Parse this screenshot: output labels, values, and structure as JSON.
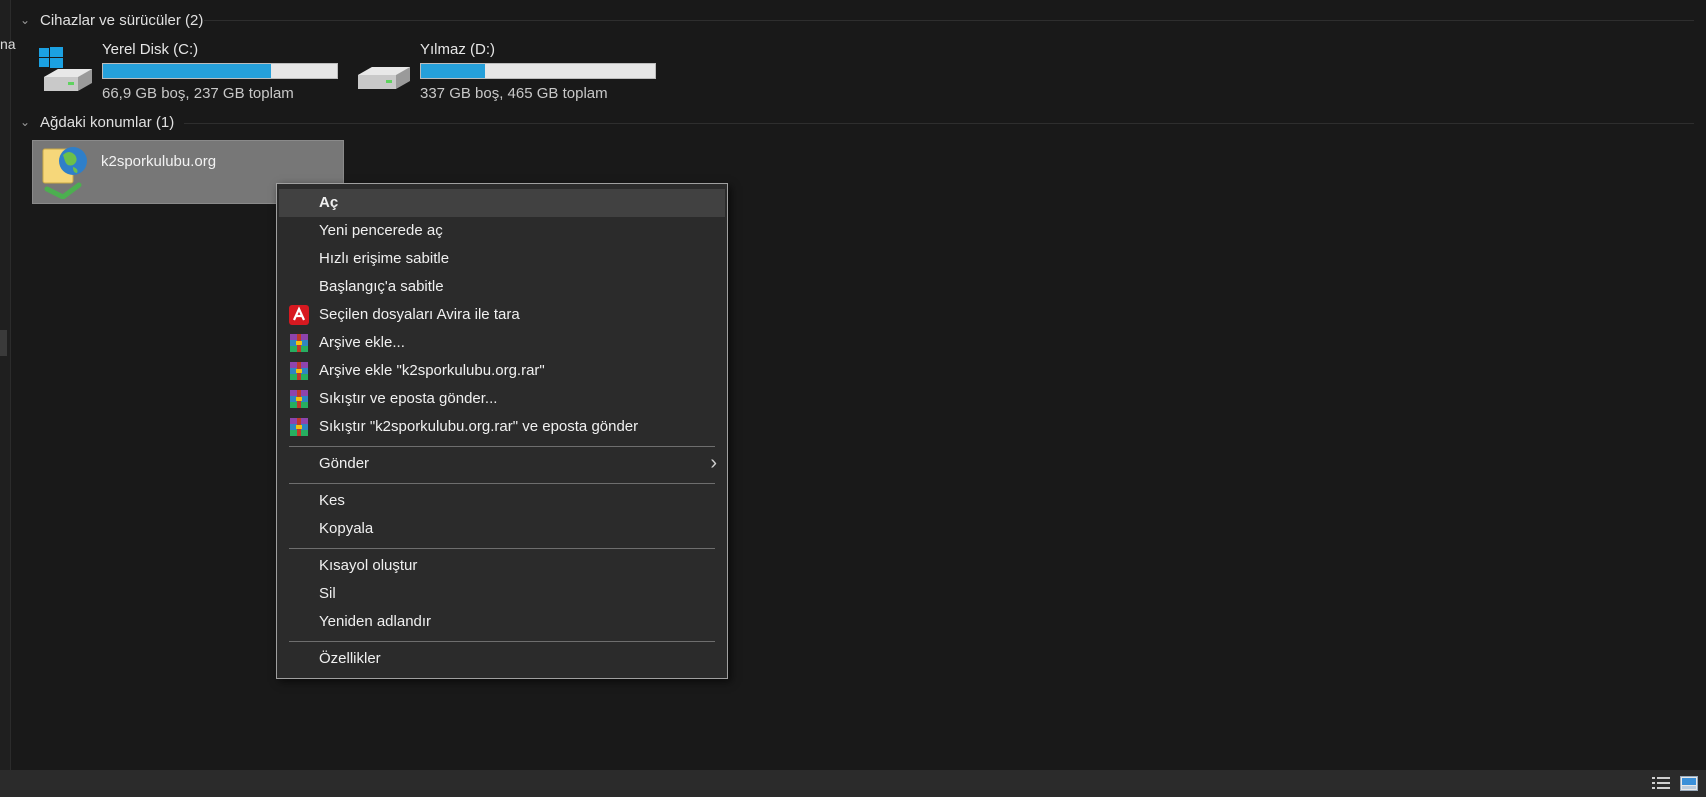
{
  "left_pane": {
    "cut_text": "na"
  },
  "groups": {
    "devices": {
      "title": "Cihazlar ve sürücüler (2)"
    },
    "network": {
      "title": "Ağdaki konumlar (1)"
    }
  },
  "drives": [
    {
      "name": "Yerel Disk (C:)",
      "free_text": "66,9 GB boş, 237 GB toplam",
      "used_fraction": 0.718,
      "icon": "windows-drive-icon"
    },
    {
      "name": "Yılmaz (D:)",
      "free_text": "337 GB boş, 465 GB toplam",
      "used_fraction": 0.275,
      "icon": "drive-icon"
    }
  ],
  "network_location": {
    "name": "k2sporkulubu.org",
    "icon": "network-location-icon"
  },
  "context_menu": {
    "items": [
      {
        "label": "Aç",
        "bold": true,
        "highlighted": true
      },
      {
        "label": "Yeni pencerede aç"
      },
      {
        "label": "Hızlı erişime sabitle"
      },
      {
        "label": "Başlangıç'a sabitle"
      },
      {
        "label": "Seçilen dosyaları Avira ile tara",
        "icon": "avira-icon"
      },
      {
        "label": "Arşive ekle...",
        "icon": "winrar-icon"
      },
      {
        "label": "Arşive ekle \"k2sporkulubu.org.rar\"",
        "icon": "winrar-icon"
      },
      {
        "label": "Sıkıştır ve eposta gönder...",
        "icon": "winrar-icon"
      },
      {
        "label": "Sıkıştır \"k2sporkulubu.org.rar\" ve eposta gönder",
        "icon": "winrar-icon"
      },
      {
        "label": "Gönder",
        "submenu": true
      },
      {
        "label": "Kes"
      },
      {
        "label": "Kopyala"
      },
      {
        "label": "Kısayol oluştur"
      },
      {
        "label": "Sil"
      },
      {
        "label": "Yeniden adlandır"
      },
      {
        "label": "Özellikler"
      }
    ]
  },
  "colors": {
    "accent": "#26a0da",
    "background": "#191919",
    "menu_bg": "#2b2b2b"
  }
}
